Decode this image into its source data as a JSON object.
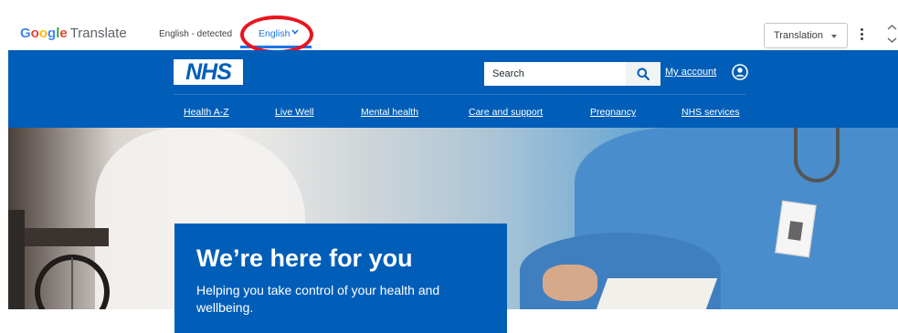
{
  "translate_bar": {
    "brand_google": "Google",
    "brand_product": "Translate",
    "source_language": "English - detected",
    "target_language": "English",
    "mode": "Translation",
    "icons": [
      "chevron-down-icon",
      "more-vert-icon",
      "collapse-icon"
    ],
    "highlight_color": "#e8141e"
  },
  "nhs": {
    "logo": "NHS",
    "brand_color": "#005eb8",
    "search": {
      "placeholder": "Search"
    },
    "account_label": "My account",
    "nav": [
      "Health A-Z",
      "Live Well",
      "Mental health",
      "Care and support",
      "Pregnancy",
      "NHS services"
    ]
  },
  "hero": {
    "title": "We’re here for you",
    "subtitle": "Helping you take control of your health and wellbeing."
  }
}
